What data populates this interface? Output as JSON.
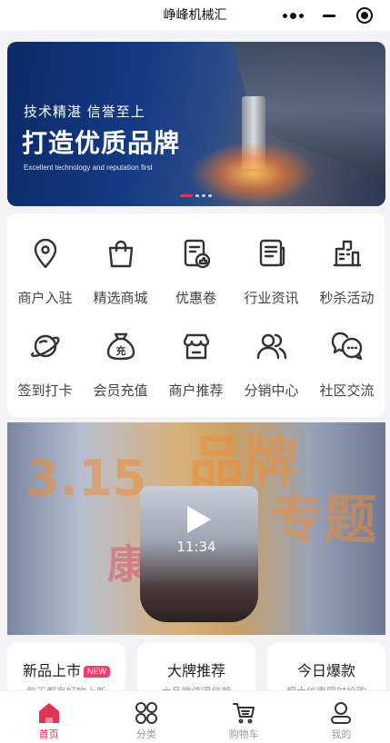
{
  "header": {
    "title": "峥峰机械汇"
  },
  "banner": {
    "tagline": "技术精湛 信誉至上",
    "headline": "打造优质品牌",
    "subline": "Excellent technology and reputation first"
  },
  "menu": {
    "items": [
      {
        "label": "商户入驻",
        "icon": "location-pin-icon"
      },
      {
        "label": "精选商城",
        "icon": "shopping-bag-icon"
      },
      {
        "label": "优惠卷",
        "icon": "coupon-icon"
      },
      {
        "label": "行业资讯",
        "icon": "news-icon"
      },
      {
        "label": "秒杀活动",
        "icon": "flash-sale-icon"
      },
      {
        "label": "签到打卡",
        "icon": "planet-icon"
      },
      {
        "label": "会员充值",
        "icon": "money-bag-icon"
      },
      {
        "label": "商户推荐",
        "icon": "store-icon"
      },
      {
        "label": "分销中心",
        "icon": "users-icon"
      },
      {
        "label": "社区交流",
        "icon": "chat-bubbles-icon"
      }
    ]
  },
  "video": {
    "duration": "11:34",
    "money_bag_glyph": "充"
  },
  "cards": [
    {
      "title": "新品上市",
      "badge": "NEW",
      "subtitle": "每天都有好物上新"
    },
    {
      "title": "大牌推荐",
      "subtitle": "大品牌值得信赖"
    },
    {
      "title": "今日爆款",
      "subtitle": "超大优惠限时抢购"
    }
  ],
  "tabbar": {
    "tabs": [
      {
        "label": "首页",
        "icon": "home-icon",
        "active": true
      },
      {
        "label": "分类",
        "icon": "category-icon",
        "active": false
      },
      {
        "label": "购物车",
        "icon": "cart-icon",
        "active": false
      },
      {
        "label": "我的",
        "icon": "profile-icon",
        "active": false
      }
    ]
  },
  "colors": {
    "accent": "#e03555",
    "inactive": "#999999",
    "icon": "#333333"
  }
}
